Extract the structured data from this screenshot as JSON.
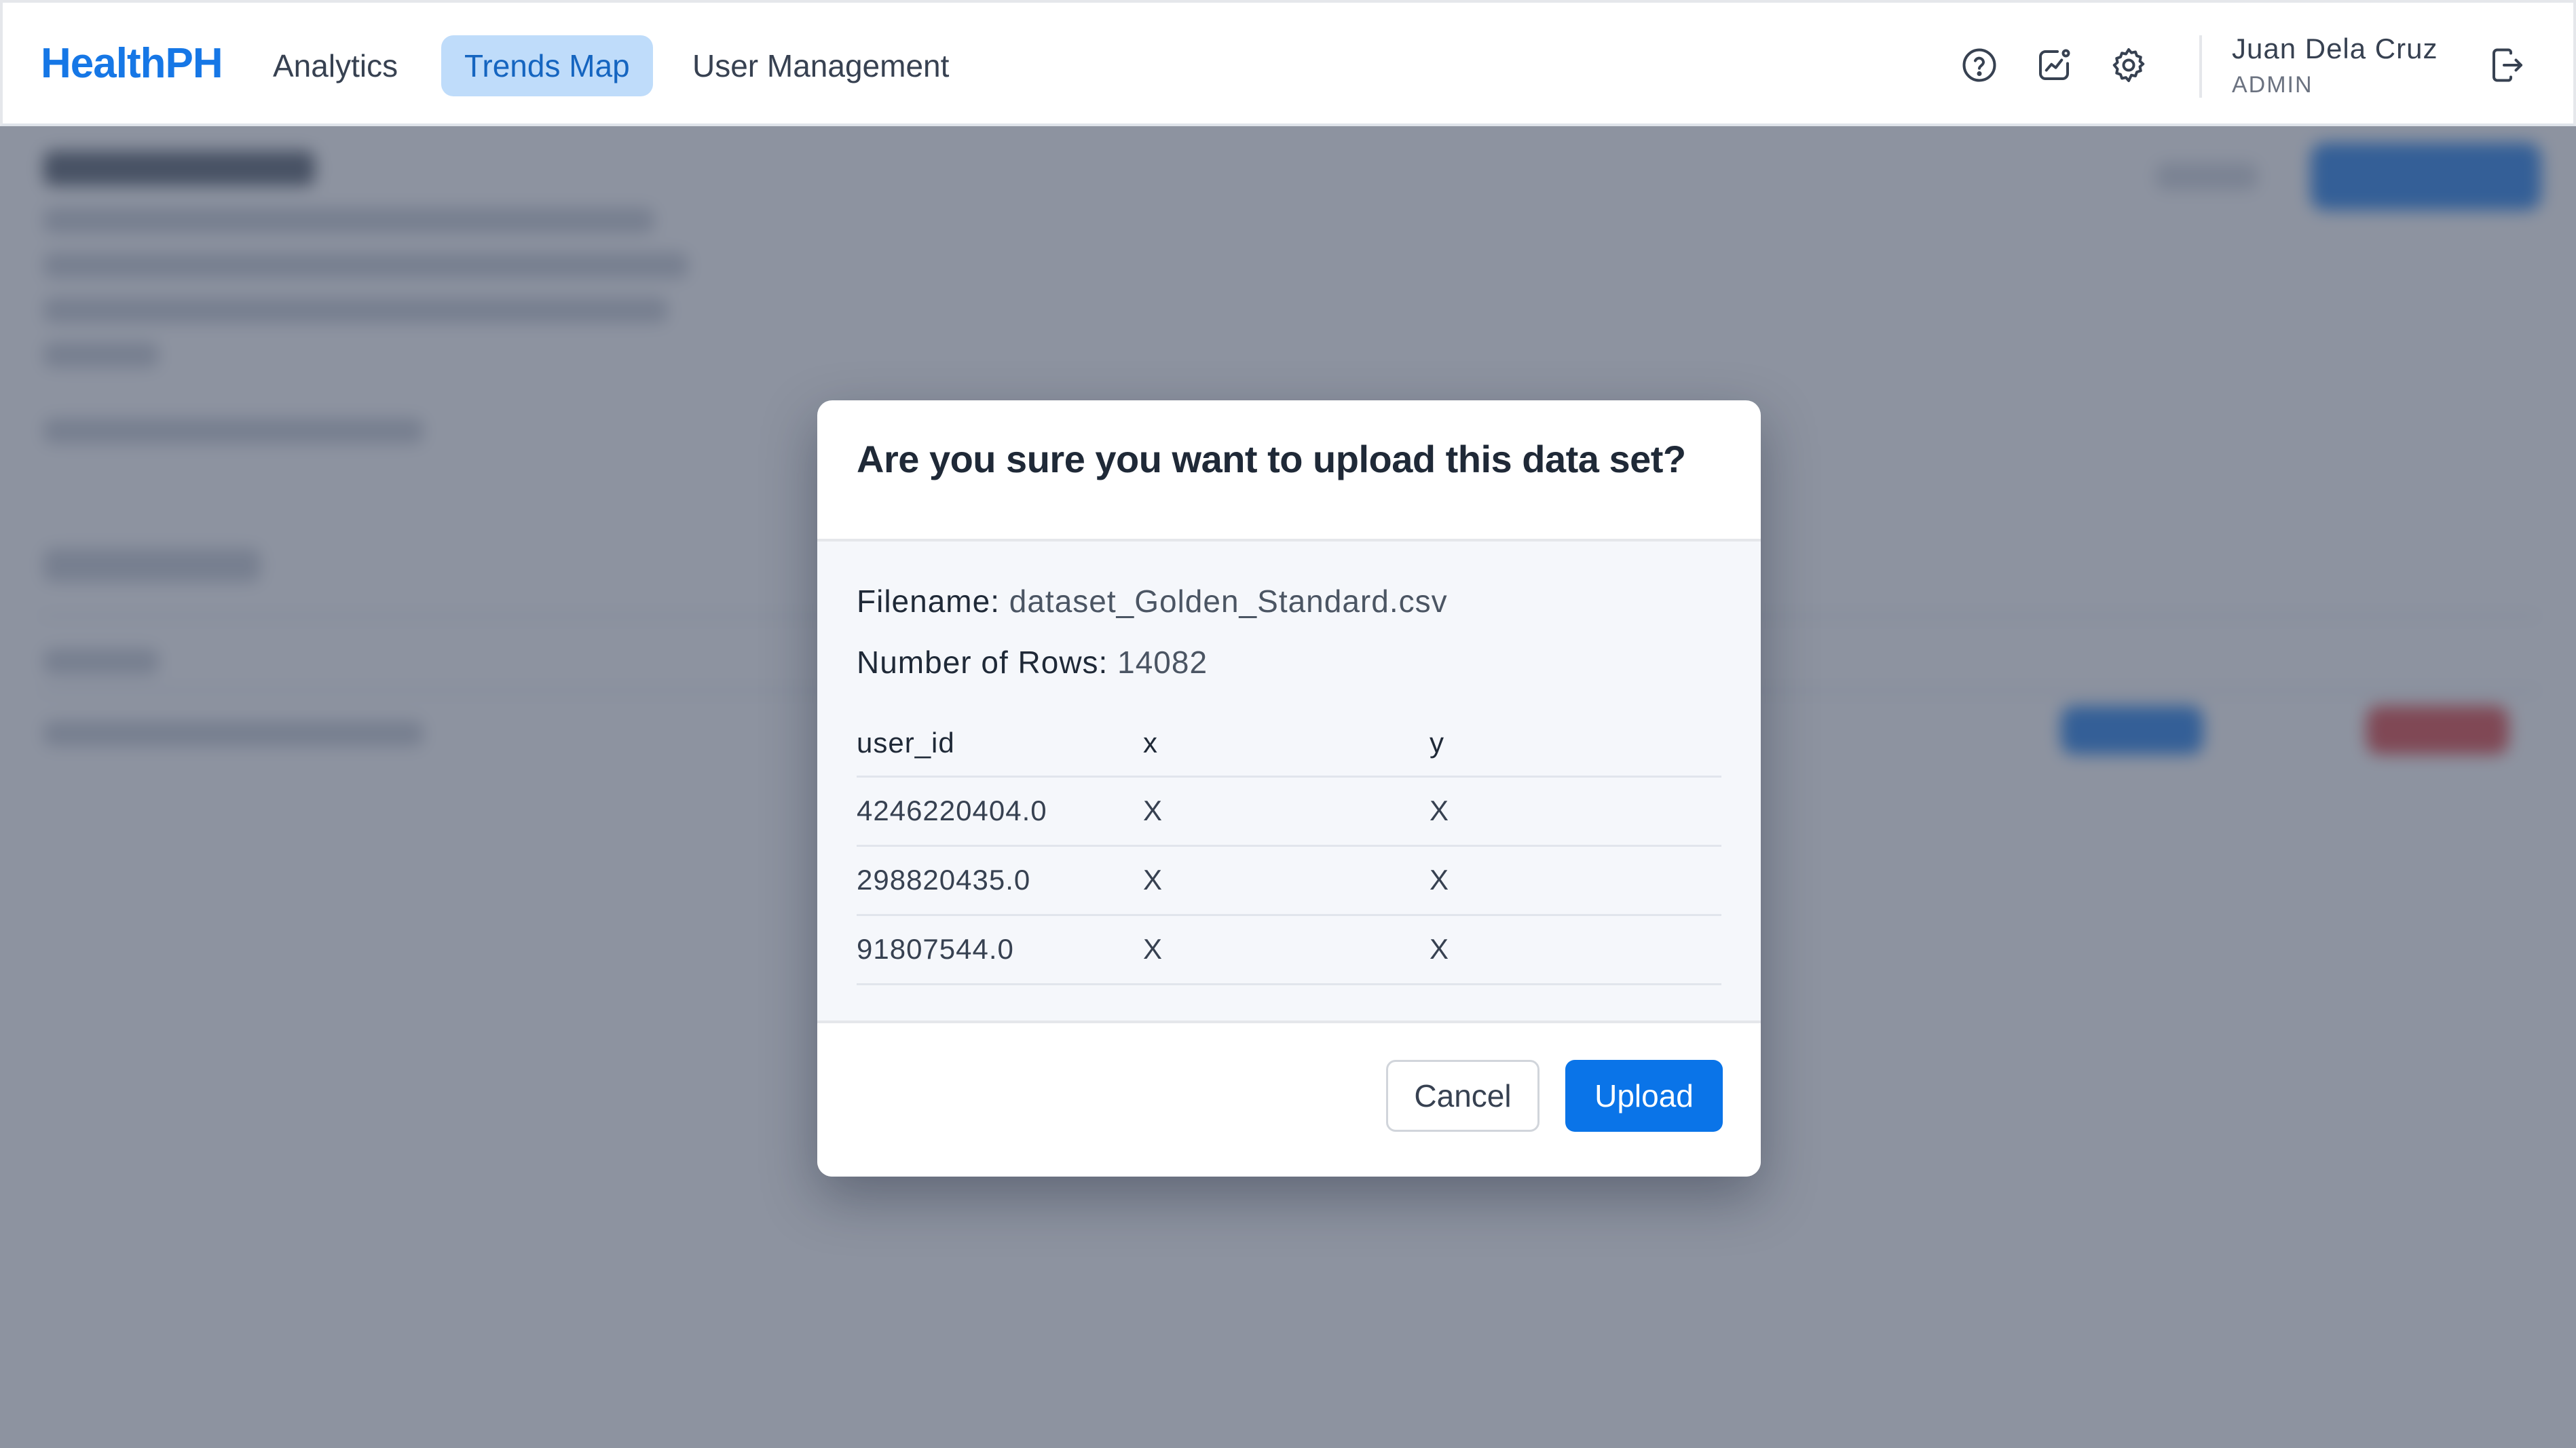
{
  "nav": {
    "brand": "HealthPH",
    "links": [
      {
        "label": "Analytics"
      },
      {
        "label": "Trends Map",
        "active": true
      },
      {
        "label": "User Management"
      }
    ],
    "icons": [
      "help-icon",
      "trend-chart-icon",
      "gear-icon",
      "logout-icon"
    ],
    "user": {
      "name": "Juan Dela Cruz",
      "role": "ADMIN"
    }
  },
  "modal": {
    "title": "Are you sure you want to upload this data set?",
    "filename_label": "Filename:",
    "filename_value": "dataset_Golden_Standard.csv",
    "rows_label": "Number of Rows:",
    "rows_value": "14082",
    "table": {
      "headers": [
        "user_id",
        "x",
        "y"
      ],
      "rows": [
        [
          "4246220404.0",
          "X",
          "X"
        ],
        [
          "298820435.0",
          "X",
          "X"
        ],
        [
          "91807544.0",
          "X",
          "X"
        ]
      ]
    },
    "cancel_label": "Cancel",
    "upload_label": "Upload"
  },
  "colors": {
    "brand": "#1677e6",
    "active_tab_bg": "#bfdcfa",
    "primary_button": "#0a74e8",
    "overlay": "#475165"
  }
}
